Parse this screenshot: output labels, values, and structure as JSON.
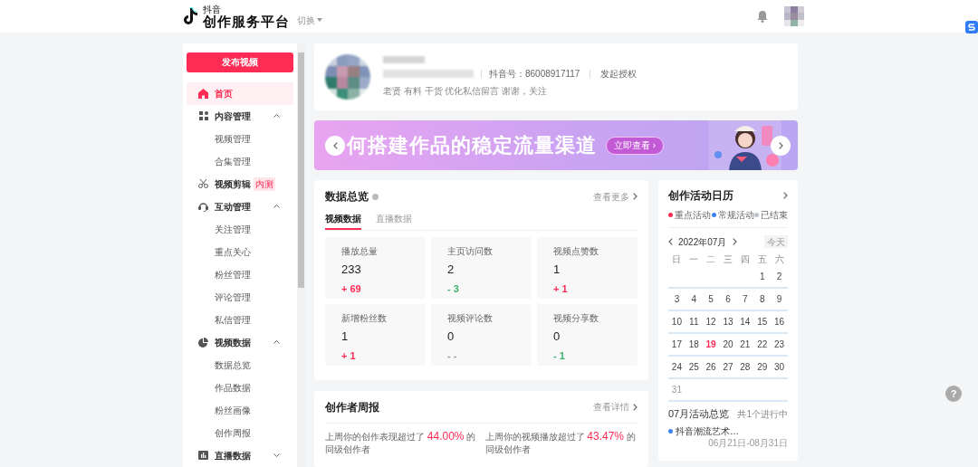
{
  "header": {
    "logo_small": "抖音",
    "logo_title": "创作服务平台",
    "switch": "切换"
  },
  "sidebar": {
    "publish": "发布视频",
    "items": [
      {
        "label": "首页",
        "kind": "home",
        "selected": true
      },
      {
        "label": "内容管理",
        "kind": "grid",
        "selected": false,
        "expanded": true,
        "children": [
          {
            "label": "视频管理",
            "selected": false
          },
          {
            "label": "合集管理",
            "selected": false
          }
        ]
      },
      {
        "label": "视频剪辑",
        "kind": "scissors",
        "selected": false,
        "badge": "内测"
      },
      {
        "label": "互动管理",
        "kind": "headset",
        "selected": false,
        "expanded": true,
        "children": [
          {
            "label": "关注管理",
            "selected": false
          },
          {
            "label": "重点关心",
            "selected": false
          },
          {
            "label": "粉丝管理",
            "selected": false
          },
          {
            "label": "评论管理",
            "selected": false
          },
          {
            "label": "私信管理",
            "selected": false
          }
        ]
      },
      {
        "label": "视频数据",
        "kind": "pie",
        "selected": false,
        "expanded": true,
        "children": [
          {
            "label": "数据总览",
            "selected": false
          },
          {
            "label": "作品数据",
            "selected": false
          },
          {
            "label": "粉丝画像",
            "selected": false
          },
          {
            "label": "创作周报",
            "selected": false
          }
        ]
      },
      {
        "label": "直播数据",
        "kind": "bars",
        "selected": false,
        "expanded": false
      }
    ]
  },
  "profile": {
    "account": "抖音号：86008917117",
    "authorize": "发起授权",
    "bio": "老贤 有料 干货 优化私信留言 谢谢，关注"
  },
  "banner": {
    "headline": "何搭建作品的稳定流量渠道",
    "cta": "立即查看 ›"
  },
  "overview": {
    "title": "数据总览",
    "more": "查看更多",
    "tabs": [
      {
        "label": "视频数据",
        "selected": true
      },
      {
        "label": "直播数据",
        "selected": false
      }
    ],
    "stats": [
      {
        "label": "播放总量",
        "value": "233",
        "delta": "+ 69",
        "color": "#fe2c55"
      },
      {
        "label": "主页访问数",
        "value": "2",
        "delta": "- 3",
        "color": "#3cb371"
      },
      {
        "label": "视频点赞数",
        "value": "1",
        "delta": "+ 1",
        "color": "#fe2c55"
      },
      {
        "label": "新增粉丝数",
        "value": "1",
        "delta": "+ 1",
        "color": "#fe2c55"
      },
      {
        "label": "视频评论数",
        "value": "0",
        "delta": "- -",
        "color": "#999999"
      },
      {
        "label": "视频分享数",
        "value": "0",
        "delta": "- 1",
        "color": "#3cb371"
      }
    ]
  },
  "weekly": {
    "title": "创作者周报",
    "more": "查看详情",
    "lines": [
      {
        "prefix": "上周你的创作表现超过了",
        "value": "44.00%",
        "suffix": "的同级创作者"
      },
      {
        "prefix": "上周你的视频播放超过了",
        "value": "43.47%",
        "suffix": "的同级创作者"
      }
    ]
  },
  "calendar": {
    "title": "创作活动日历",
    "legend": [
      {
        "label": "重点活动",
        "color": "#fe2c55"
      },
      {
        "label": "常规活动",
        "color": "#3b82f6"
      },
      {
        "label": "已结束",
        "color": "#c0c4cc"
      }
    ],
    "month": "2022年07月",
    "today_button": "今天",
    "weekdays": [
      "日",
      "一",
      "二",
      "三",
      "四",
      "五",
      "六"
    ],
    "weeks": [
      [
        {
          "d": "1",
          "today": false
        },
        {
          "d": "2",
          "today": false
        }
      ],
      [
        {
          "d": "3",
          "today": false
        },
        {
          "d": "4",
          "today": false
        },
        {
          "d": "5",
          "today": false
        },
        {
          "d": "6",
          "today": false
        },
        {
          "d": "7",
          "today": false
        },
        {
          "d": "8",
          "today": false
        },
        {
          "d": "9",
          "today": false
        }
      ],
      [
        {
          "d": "10",
          "today": false
        },
        {
          "d": "11",
          "today": false
        },
        {
          "d": "12",
          "today": false
        },
        {
          "d": "13",
          "today": false
        },
        {
          "d": "14",
          "today": false
        },
        {
          "d": "15",
          "today": false
        },
        {
          "d": "16",
          "today": false
        }
      ],
      [
        {
          "d": "17",
          "today": false
        },
        {
          "d": "18",
          "today": false
        },
        {
          "d": "19",
          "today": true
        },
        {
          "d": "20",
          "today": false
        },
        {
          "d": "21",
          "today": false
        },
        {
          "d": "22",
          "today": false
        },
        {
          "d": "23",
          "today": false
        }
      ],
      [
        {
          "d": "24",
          "today": false
        },
        {
          "d": "25",
          "today": false
        },
        {
          "d": "26",
          "today": false
        },
        {
          "d": "27",
          "today": false
        },
        {
          "d": "28",
          "today": false
        },
        {
          "d": "29",
          "today": false
        },
        {
          "d": "30",
          "today": false
        }
      ],
      [
        {
          "d": "31",
          "today": false
        }
      ]
    ],
    "summary_title": "07月活动总览",
    "summary_count": "共1个进行中",
    "activities": [
      {
        "name": "抖音潮流艺术…",
        "dates": "06月21日-08月31日",
        "color": "#3b82f6"
      }
    ]
  },
  "help": "?"
}
